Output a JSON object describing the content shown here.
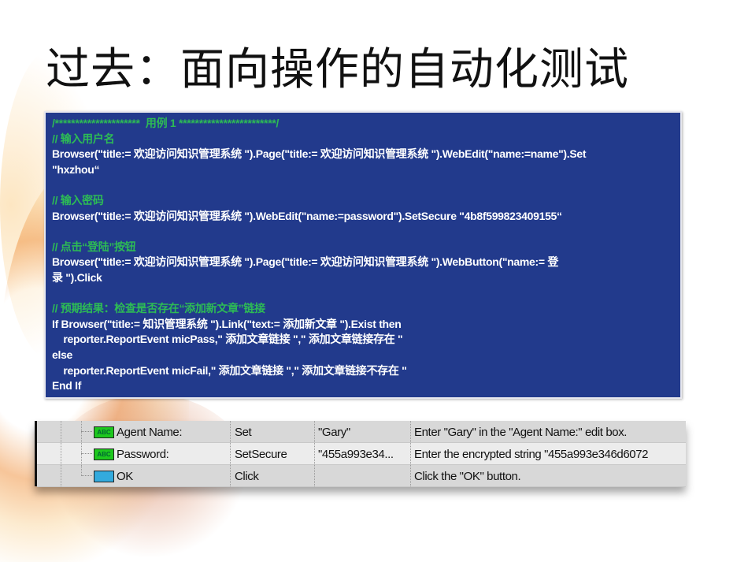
{
  "title": "过去：面向操作的自动化测试",
  "code": [
    {
      "t": "/*********************  用例 1 ************************/",
      "comment": true
    },
    {
      "t": "// 输入用户名",
      "comment": true
    },
    {
      "t": "Browser(\"title:= 欢迎访问知识管理系统 \").Page(\"title:= 欢迎访问知识管理系统 \").WebEdit(\"name:=name\").Set",
      "comment": false
    },
    {
      "t": "\"hxzhou“",
      "comment": false
    },
    {
      "t": "",
      "comment": false
    },
    {
      "t": "// 输入密码",
      "comment": true
    },
    {
      "t": "Browser(\"title:= 欢迎访问知识管理系统 \").WebEdit(\"name:=password\").SetSecure \"4b8f599823409155“",
      "comment": false
    },
    {
      "t": "",
      "comment": false
    },
    {
      "t": "// 点击“登陆”按钮",
      "comment": true
    },
    {
      "t": "Browser(\"title:= 欢迎访问知识管理系统 \").Page(\"title:= 欢迎访问知识管理系统 \").WebButton(\"name:= 登",
      "comment": false
    },
    {
      "t": "录 \").Click",
      "comment": false
    },
    {
      "t": "",
      "comment": false
    },
    {
      "t": "// 预期结果：检查是否存在“添加新文章”链接",
      "comment": true
    },
    {
      "t": "If Browser(\"title:= 知识管理系统 \").Link(\"text:= 添加新文章 \").Exist then",
      "comment": false
    },
    {
      "t": "    reporter.ReportEvent micPass,\" 添加文章链接 \",\" 添加文章链接存在 \"",
      "comment": false
    },
    {
      "t": "else",
      "comment": false
    },
    {
      "t": "    reporter.ReportEvent micFail,\" 添加文章链接 \",\" 添加文章链接不存在 \"",
      "comment": false
    },
    {
      "t": "End If",
      "comment": false
    }
  ],
  "steps": [
    {
      "icon": "ABC",
      "item": "Agent Name:",
      "operation": "Set",
      "value": "\"Gary\"",
      "documentation": "Enter \"Gary\" in the \"Agent Name:\" edit box."
    },
    {
      "icon": "ABC",
      "item": "Password:",
      "operation": "SetSecure",
      "value": "\"455a993e34...",
      "documentation": "Enter the encrypted string \"455a993e346d6072"
    },
    {
      "icon": "",
      "item": "OK",
      "operation": "Click",
      "value": "",
      "documentation": "Click the \"OK\" button."
    }
  ]
}
